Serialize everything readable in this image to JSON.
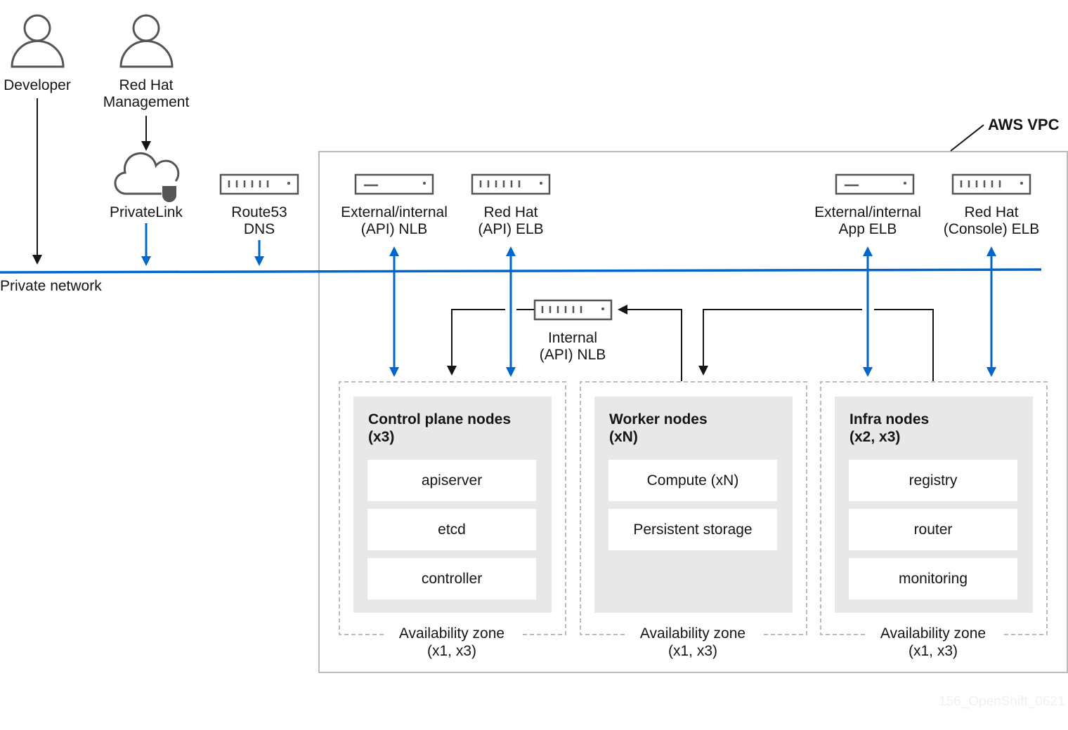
{
  "actors": {
    "developer": "Developer",
    "redhat_mgmt": [
      "Red Hat",
      "Management"
    ]
  },
  "privatelink": "PrivateLink",
  "route53": [
    "Route53",
    "DNS"
  ],
  "private_network": "Private network",
  "vpc_label": "AWS VPC",
  "load_balancers": {
    "ext_api_nlb": [
      "External/internal",
      "(API) NLB"
    ],
    "rh_api_elb": [
      "Red Hat",
      "(API) ELB"
    ],
    "ext_app_elb": [
      "External/internal",
      "App ELB"
    ],
    "rh_console_elb": [
      "Red Hat",
      "(Console) ELB"
    ],
    "int_api_nlb": [
      "Internal",
      "(API) NLB"
    ]
  },
  "zones": [
    {
      "title": [
        "Control plane nodes",
        "(x3)"
      ],
      "items": [
        "apiserver",
        "etcd",
        "controller"
      ],
      "az": [
        "Availability zone",
        "(x1, x3)"
      ]
    },
    {
      "title": [
        "Worker nodes",
        "(xN)"
      ],
      "items": [
        "Compute (xN)",
        "Persistent storage"
      ],
      "az": [
        "Availability zone",
        "(x1, x3)"
      ]
    },
    {
      "title": [
        "Infra nodes",
        "(x2, x3)"
      ],
      "items": [
        "registry",
        "router",
        "monitoring"
      ],
      "az": [
        "Availability zone",
        "(x1, x3)"
      ]
    }
  ],
  "watermark": "156_OpenShift_0621",
  "colors": {
    "network": "#0066cc",
    "text": "#151515",
    "node_bg": "#e8e8e8",
    "border": "#bbbbbb"
  }
}
